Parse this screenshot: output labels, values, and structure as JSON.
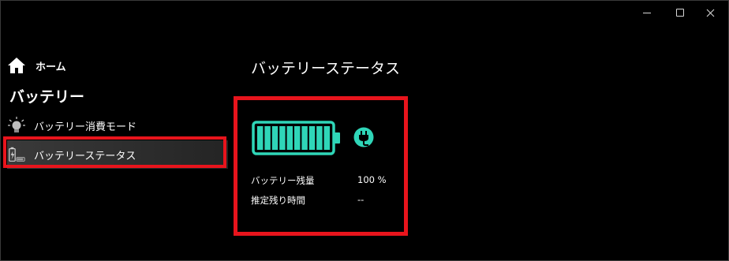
{
  "window_controls": {
    "minimize": "minimize",
    "maximize": "maximize",
    "close": "close"
  },
  "sidebar": {
    "home_label": "ホーム",
    "section_title": "バッテリー",
    "items": [
      {
        "label": "バッテリー消費モード",
        "icon": "lightbulb-icon"
      },
      {
        "label": "バッテリーステータス",
        "icon": "battery-charging-icon",
        "selected": true
      }
    ]
  },
  "main": {
    "title": "バッテリーステータス",
    "battery": {
      "level_fraction": 1.0,
      "segments": 10,
      "charging": true,
      "color": "#2fd6b8"
    },
    "rows": [
      {
        "label": "バッテリー残量",
        "value": "100 %"
      },
      {
        "label": "推定残り時間",
        "value": "--"
      }
    ]
  },
  "colors": {
    "accent": "#2fd6b8",
    "highlight": "#e8141c",
    "background": "#000000"
  }
}
